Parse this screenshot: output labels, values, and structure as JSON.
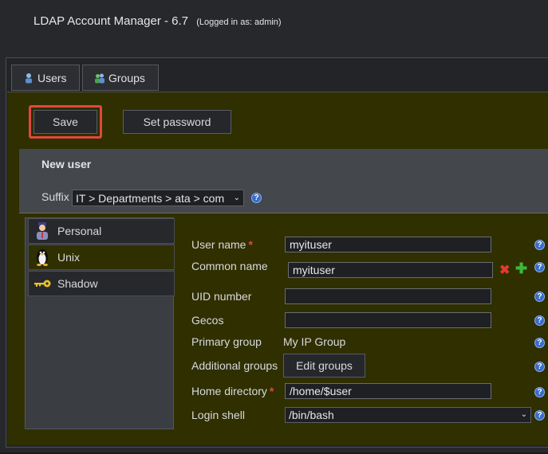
{
  "header": {
    "title": "LDAP Account Manager - 6.7",
    "login": "(Logged in as: admin)"
  },
  "tabs": [
    {
      "label": "Users",
      "icon": "user-icon"
    },
    {
      "label": "Groups",
      "icon": "group-icon"
    }
  ],
  "toolbar": {
    "save_label": "Save",
    "set_password_label": "Set password"
  },
  "form_header": {
    "title": "New user",
    "suffix_label": "Suffix",
    "suffix_value": "IT > Departments > ata > com"
  },
  "sidebar": {
    "items": [
      {
        "label": "Personal",
        "icon": "personal-icon"
      },
      {
        "label": "Unix",
        "icon": "tux-icon"
      },
      {
        "label": "Shadow",
        "icon": "key-icon"
      }
    ]
  },
  "fields": {
    "user_name": {
      "label": "User name",
      "value": "myituser"
    },
    "common_name": {
      "label": "Common name",
      "value": "myituser"
    },
    "uid_number": {
      "label": "UID number",
      "value": ""
    },
    "gecos": {
      "label": "Gecos",
      "value": ""
    },
    "primary_group": {
      "label": "Primary group",
      "value": "My IP Group"
    },
    "additional_groups": {
      "label": "Additional groups",
      "button": "Edit groups"
    },
    "home_directory": {
      "label": "Home directory",
      "value": "/home/$user"
    },
    "login_shell": {
      "label": "Login shell",
      "value": "/bin/bash"
    }
  },
  "required_mark": "*",
  "help_glyph": "?",
  "colors": {
    "accent_red": "#e0483f",
    "olive_bg": "#2f2f00",
    "help_blue": "#3a6cc8"
  }
}
